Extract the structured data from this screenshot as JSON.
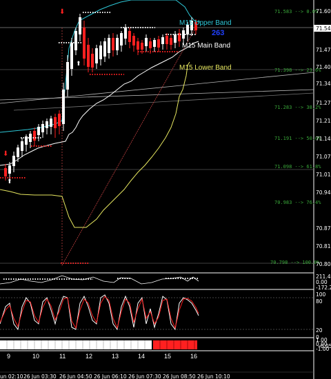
{
  "colors": {
    "background": "#000000",
    "upper_band": "#2ec8d8",
    "main_band": "#ffffff",
    "lower_band": "#e8e860",
    "fib": "#3aa83a",
    "bull": "#ffffff",
    "bear": "#ff2020",
    "counter": "#2040ff"
  },
  "bands": {
    "upper": "M15 Upper Band",
    "main": "M15 Main Band",
    "lower": "M15 Lower Band"
  },
  "counter": "263",
  "fib_levels": [
    "71.583 --> 0.0%",
    "71.398 --> 23.6%",
    "71.283 --> 38.2%",
    "71.191 --> 50.0%",
    "71.098 --> 61.8%",
    "70.983 --> 76.4%",
    "70.798 --> 100.0%"
  ],
  "price_axis": [
    "71.540",
    "71.475",
    "71.405",
    "71.340",
    "71.275",
    "71.210",
    "71.140",
    "71.075",
    "71.010",
    "70.940",
    "70.875",
    "70.810"
  ],
  "price_axis_top": "71.605",
  "price_axis_bottom": "70.800",
  "ind1_axis": [
    "211.43",
    "0.00",
    "-172.24"
  ],
  "ind2_axis": [
    "100",
    "80",
    "20",
    "0"
  ],
  "ind3_axis": [
    "1.00",
    "0.00",
    "-1.00"
  ],
  "ind3_overlap": "-0.05",
  "hour_ticks": [
    "9",
    "10",
    "11",
    "12",
    "13",
    "14",
    "15",
    "16"
  ],
  "time_labels": [
    "un 02:10",
    "26 Jun 03:30",
    "26 Jun 04:50",
    "26 Jun 06:10",
    "26 Jun 07:30",
    "26 Jun 08:50",
    "26 Jun 10:10"
  ]
}
